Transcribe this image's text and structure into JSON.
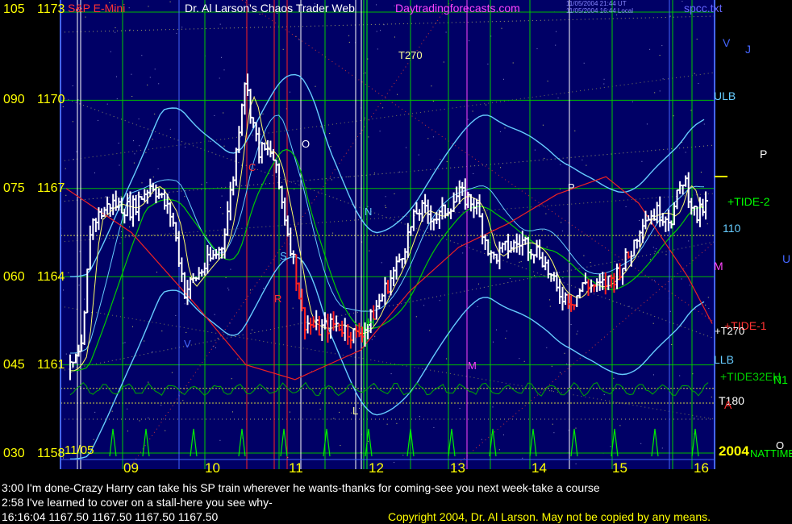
{
  "header": {
    "title_left": "S&P E-Mini",
    "title_main": "Dr. Al Larson's Chaos Trader Web",
    "title_site": "Daytradingforecasts.com",
    "stamp_line1": "11/05/2004 21:44 UT",
    "stamp_line2": "11/05/2004 16:44 Local",
    "filename": "spcc.txt"
  },
  "chart_data": {
    "type": "candlestick",
    "title": "Dr. Al Larson's Chaos Trader Web",
    "instrument": "S&P E-Mini",
    "date_label": "11/05",
    "year_label": "2004",
    "y_axis": {
      "price_range": [
        1158,
        1173
      ],
      "ticks": [
        {
          "left": "105",
          "price": "1173"
        },
        {
          "left": "090",
          "price": "1170"
        },
        {
          "left": "075",
          "price": "1167"
        },
        {
          "left": "060",
          "price": "1164"
        },
        {
          "left": "045",
          "price": "1161"
        },
        {
          "left": "030",
          "price": "1158"
        }
      ]
    },
    "x_axis": {
      "ticks": [
        "09",
        "10",
        "11",
        "12",
        "13",
        "14",
        "15",
        "16"
      ],
      "range_hours": [
        8.2,
        16.1
      ]
    },
    "price_series": {
      "time": [
        8.25,
        8.4,
        8.5,
        8.75,
        9.0,
        9.25,
        9.5,
        9.65,
        9.85,
        10.1,
        10.25,
        10.38,
        10.55,
        10.72,
        10.85,
        11.0,
        11.1,
        11.3,
        11.5,
        11.75,
        11.9,
        12.05,
        12.25,
        12.5,
        12.75,
        13.0,
        13.2,
        13.4,
        13.6,
        13.8,
        14.0,
        14.2,
        14.4,
        14.55,
        14.7,
        14.9,
        15.1,
        15.25,
        15.45,
        15.6,
        15.75,
        15.9,
        16.05
      ],
      "price": [
        1160.8,
        1161.5,
        1165.8,
        1166.5,
        1166.3,
        1167.2,
        1166.0,
        1163.5,
        1164.2,
        1165.0,
        1167.5,
        1170.8,
        1168.3,
        1168.2,
        1166.4,
        1164.3,
        1162.5,
        1162.2,
        1162.4,
        1162.0,
        1162.4,
        1163.3,
        1164.4,
        1166.3,
        1166.0,
        1166.8,
        1166.5,
        1164.6,
        1165.0,
        1165.2,
        1164.8,
        1163.5,
        1163.2,
        1163.8,
        1163.6,
        1164.0,
        1164.8,
        1166.0,
        1166.2,
        1166.0,
        1167.4,
        1166.0,
        1166.5
      ]
    },
    "right_labels": [
      "V",
      "J",
      "ULB",
      "P",
      "+TIDE-2",
      "110",
      "U",
      "M",
      "+TIDE-1",
      "+T270",
      "LLB",
      "+TIDE32EH",
      "N1",
      "T180",
      "A",
      "O",
      "NATTIME"
    ],
    "chart_letters": [
      "T270",
      "O",
      "C",
      "N",
      "P",
      "S",
      "R",
      "H",
      "V",
      "M",
      "L"
    ],
    "colors": {
      "background": "#000066",
      "axis_text": "#ffff00",
      "up_bars": "#ffffff",
      "down_bars": "#ff0000",
      "grid_green": "#00cc00",
      "band_cyan": "#66ccff",
      "title_magenta": "#ff44ff"
    }
  },
  "messages": [
    "3:00 I'm done-Crazy Harry can take his SP train wherever he wants-thanks for coming-see you next week-take a course",
    "2:58 I've learned to cover on a stall-here you see why-"
  ],
  "footer": {
    "quote": "16:16:04   1167.50 1167.50 1167.50 1167.50",
    "copyright": "Copyright 2004, Dr. Al Larson. May not be copied by any means."
  }
}
